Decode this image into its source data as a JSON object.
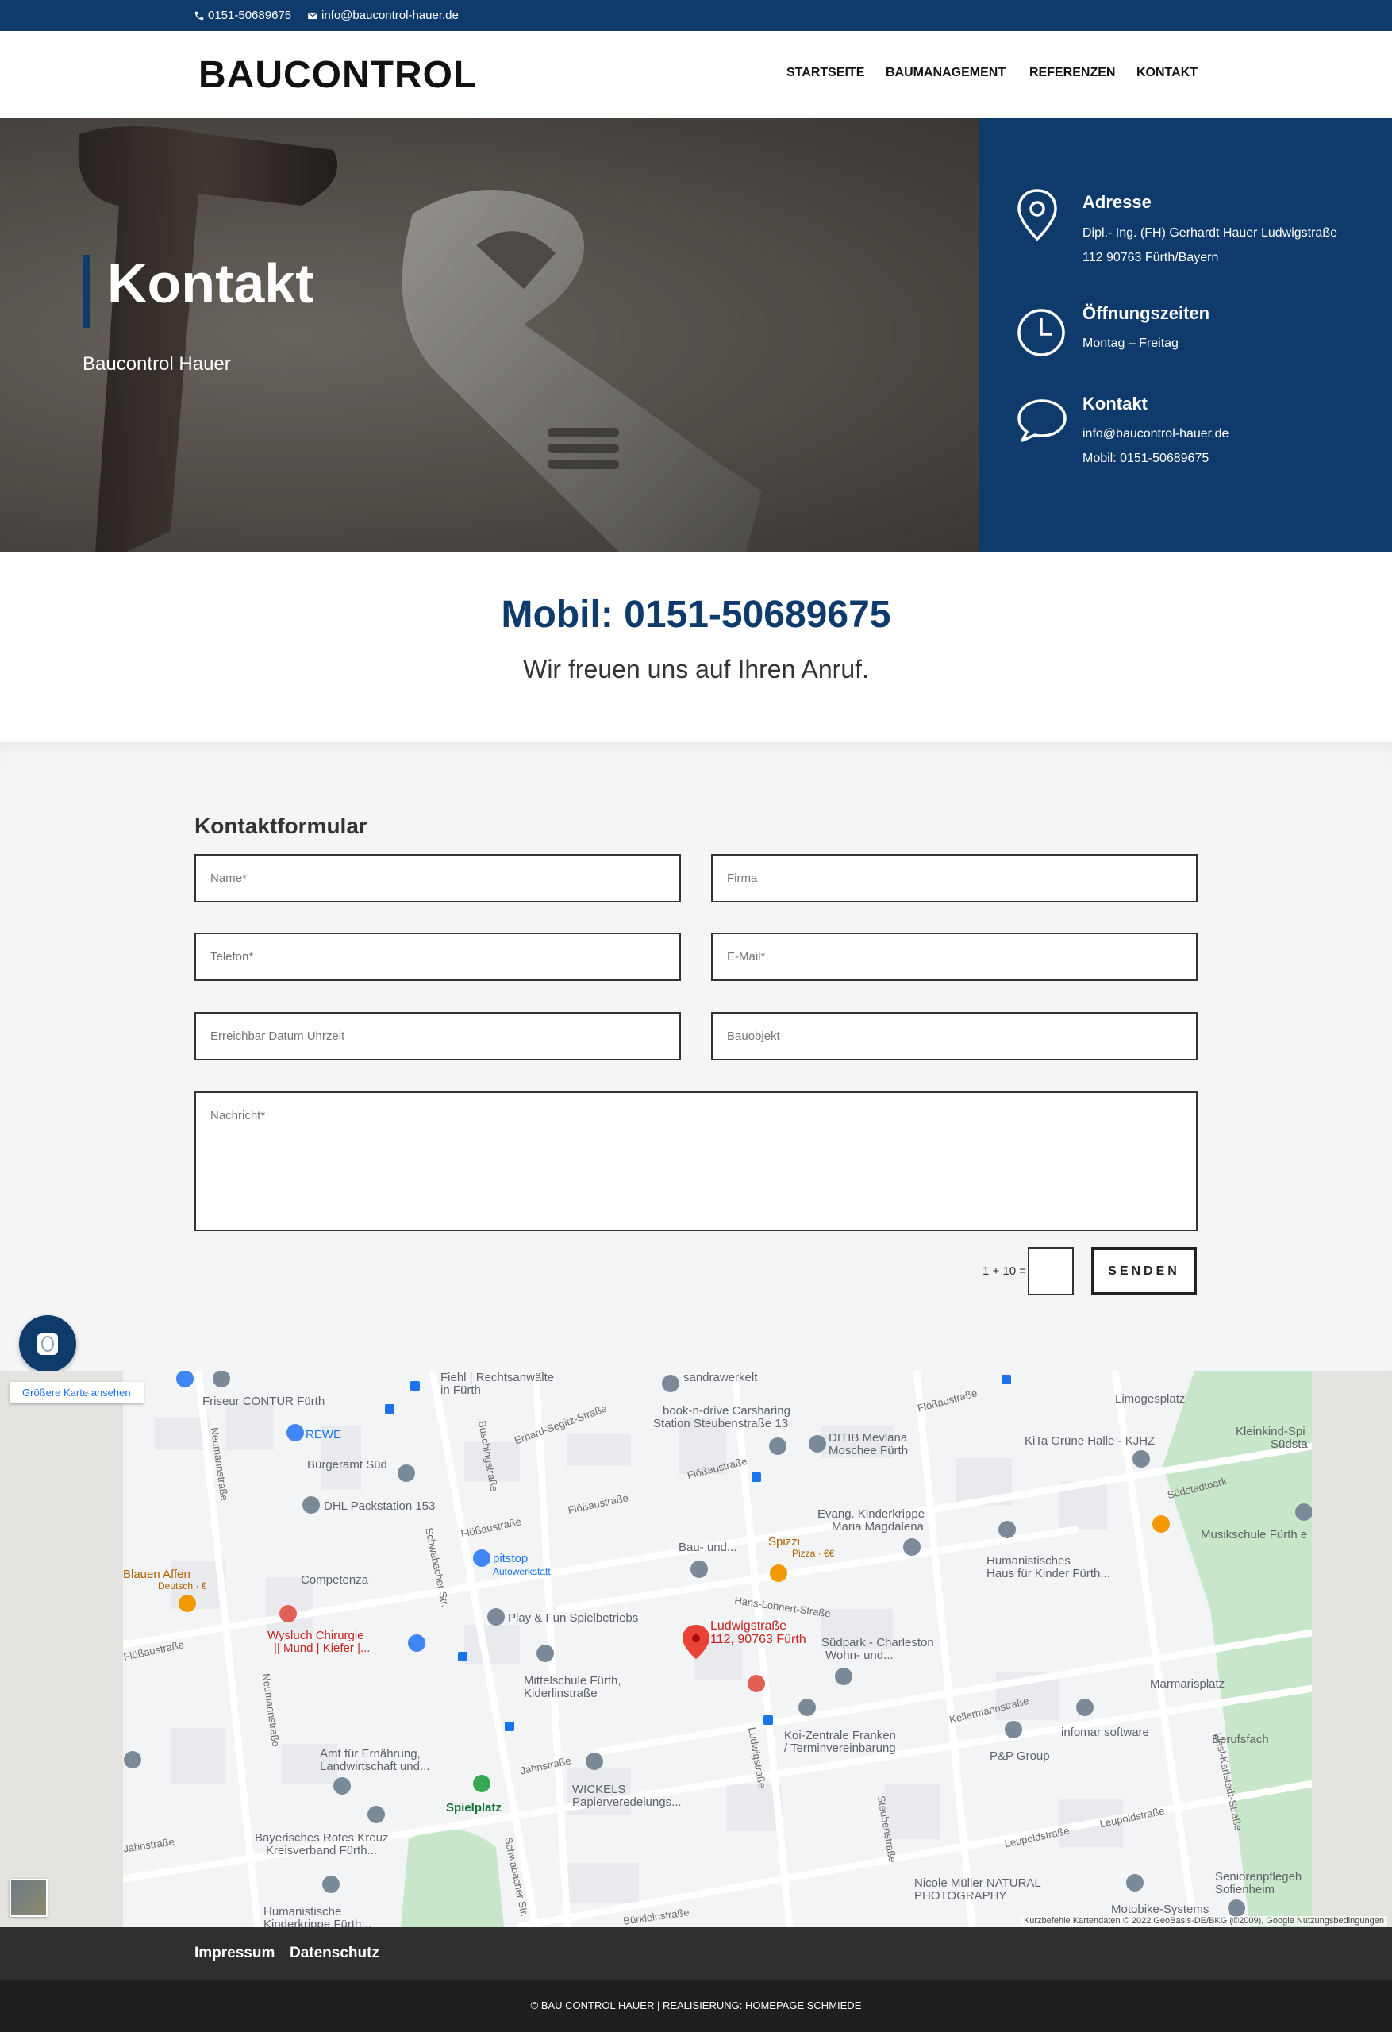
{
  "topbar": {
    "phone": "0151-50689675",
    "email": "info@baucontrol-hauer.de"
  },
  "header": {
    "logo": "BAUCONTROL",
    "nav": [
      "STARTSEITE",
      "BAUMANAGEMENT",
      "REFERENZEN",
      "KONTAKT"
    ]
  },
  "hero": {
    "title": "Kontakt",
    "subtitle": "Baucontrol Hauer",
    "address_title": "Adresse",
    "address_line1": "Dipl.- Ing. (FH) Gerhardt Hauer Ludwigstraße",
    "address_line2": "112 90763 Fürth/Bayern",
    "hours_title": "Öffnungszeiten",
    "hours_line": "Montag – Freitag",
    "contact_title": "Kontakt",
    "contact_email": "info@baucontrol-hauer.de",
    "contact_mobile": "Mobil: 0151-50689675"
  },
  "mobile": {
    "title": "Mobil: 0151-50689675",
    "subtitle": "Wir freuen uns auf Ihren Anruf."
  },
  "form": {
    "heading": "Kontaktformular",
    "placeholders": {
      "name": "Name*",
      "firma": "Firma",
      "telefon": "Telefon*",
      "email": "E-Mail*",
      "erreichbar": "Erreichbar Datum Uhrzeit",
      "bauobjekt": "Bauobjekt",
      "nachricht": "Nachricht*"
    },
    "captcha": "1 + 10 =",
    "send": "SENDEN"
  },
  "map": {
    "larger_map": "Größere Karte ansehen",
    "pin_label_1": "Ludwigstraße",
    "pin_label_2": "112, 90763 Fürth",
    "labels": [
      "Fiehl | Rechtsanwälte",
      "in Fürth",
      "sandrawerkelt",
      "Friseur CONTUR Fürth",
      "REWE",
      "Bürgeramt Süd",
      "DHL Packstation 153",
      "book-n-drive Carsharing",
      "Station Steubenstraße 13",
      "DITIB Mevlana",
      "Moschee Fürth",
      "Limogesplatz",
      "KiTa Grüne Halle - KJHZ",
      "Kleinkind-Spi",
      "Südsta",
      "pitstop",
      "Autowerkstatt",
      "Competenza",
      "Blauen Affen",
      "Deutsch · €",
      "Wysluch Chirurgie",
      "|| Mund | Kiefer |...",
      "Play & Fun Spielbetriebs",
      "Bau- und...",
      "Spizzi",
      "Pizza · €€",
      "Evang. Kinderkrippe",
      "Maria Magdalena",
      "Humanistisches",
      "Haus für Kinder Fürth...",
      "Musikschule Fürth e",
      "Mittelschule Fürth,",
      "Kiderlinstraße",
      "Südpark - Charleston",
      "Wohn- und...",
      "Marmarisplatz",
      "Koi-Zentrale Franken",
      "/ Terminvereinbarung",
      "infomar software",
      "P&P Group",
      "Berufsfach",
      "Amt für Ernährung,",
      "Landwirtschaft und...",
      "Spielplatz",
      "WICKELS",
      "Papierveredelungs...",
      "Bayerisches Rotes Kreuz",
      "Kreisverband Fürth...",
      "Humanistische",
      "Kinderkrippe Fürth...",
      "Nicole Müller NATURAL",
      "PHOTOGRAPHY",
      "Seniorenpflegeh",
      "Sofienheim",
      "Motobike-Systems"
    ],
    "streets": [
      "Erhard-Segitz-Straße",
      "Flößaustraße",
      "Flößaustraße",
      "Flößaustraße",
      "Flößaustraße",
      "Flößaustraße",
      "Neumannstraße",
      "Neumannstraße",
      "Schwabacher Str.",
      "Schwabacher Str.",
      "Buschingstraße",
      "Hans-Lohnert-Straße",
      "Kellermannstraße",
      "Leupoldstraße",
      "Leupoldstraße",
      "Liesl-Karlstadt-Straße",
      "Jahnstraße",
      "Jahnstraße",
      "Ludwigstraße",
      "Steubenstraße",
      "Südstadtpark",
      "Bürklelnstraße"
    ],
    "footer": "Kurzbefehle    Kartendaten © 2022 GeoBasis-DE/BKG (©2009), Google    Nutzungsbedingungen"
  },
  "footer": {
    "links": [
      "Impressum",
      "Datenschutz"
    ],
    "copyright": "© BAU CONTROL HAUER | REALISIERUNG: HOMEPAGE SCHMIEDE"
  },
  "colors": {
    "brand": "#0e3a6c",
    "pin": "#ea4335"
  },
  "icons": [
    "phone-icon",
    "mail-icon",
    "location-pin-icon",
    "clock-icon",
    "speech-bubble-icon",
    "fingerprint-icon",
    "map-pin-icon"
  ]
}
